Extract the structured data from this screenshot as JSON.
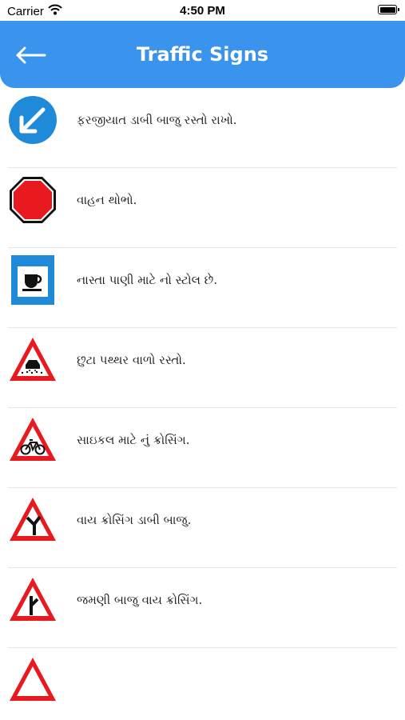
{
  "status_bar": {
    "carrier": "Carrier",
    "time": "4:50 PM",
    "battery_level": 1.0
  },
  "header": {
    "title": "Traffic Signs",
    "back_icon": "arrow-left-icon"
  },
  "signs": [
    {
      "label": "ફરજીયાત ડાબી બાજુ રસ્તો રાખો.",
      "icon": "keep-left-sign-icon"
    },
    {
      "label": "વાહન થોભો.",
      "icon": "stop-sign-icon"
    },
    {
      "label": "નાસ્તા પાણી માટે નો સ્ટોલ છે.",
      "icon": "refreshment-stall-sign-icon"
    },
    {
      "label": "છુટા પથ્થર વાળો રસ્તો.",
      "icon": "loose-gravel-sign-icon"
    },
    {
      "label": "સાઇકલ માટે નું ક્રોસિંગ.",
      "icon": "cycle-crossing-sign-icon"
    },
    {
      "label": "વાય ક્રોસિંગ ડાબી બાજુ.",
      "icon": "y-intersection-left-sign-icon"
    },
    {
      "label": "જમણી બાજુ વાય ક્રોસિંગ.",
      "icon": "y-intersection-right-sign-icon"
    }
  ],
  "colors": {
    "app_bar": "#3a93ed",
    "sign_red": "#e53935",
    "sign_blue": "#1f8ad8"
  }
}
